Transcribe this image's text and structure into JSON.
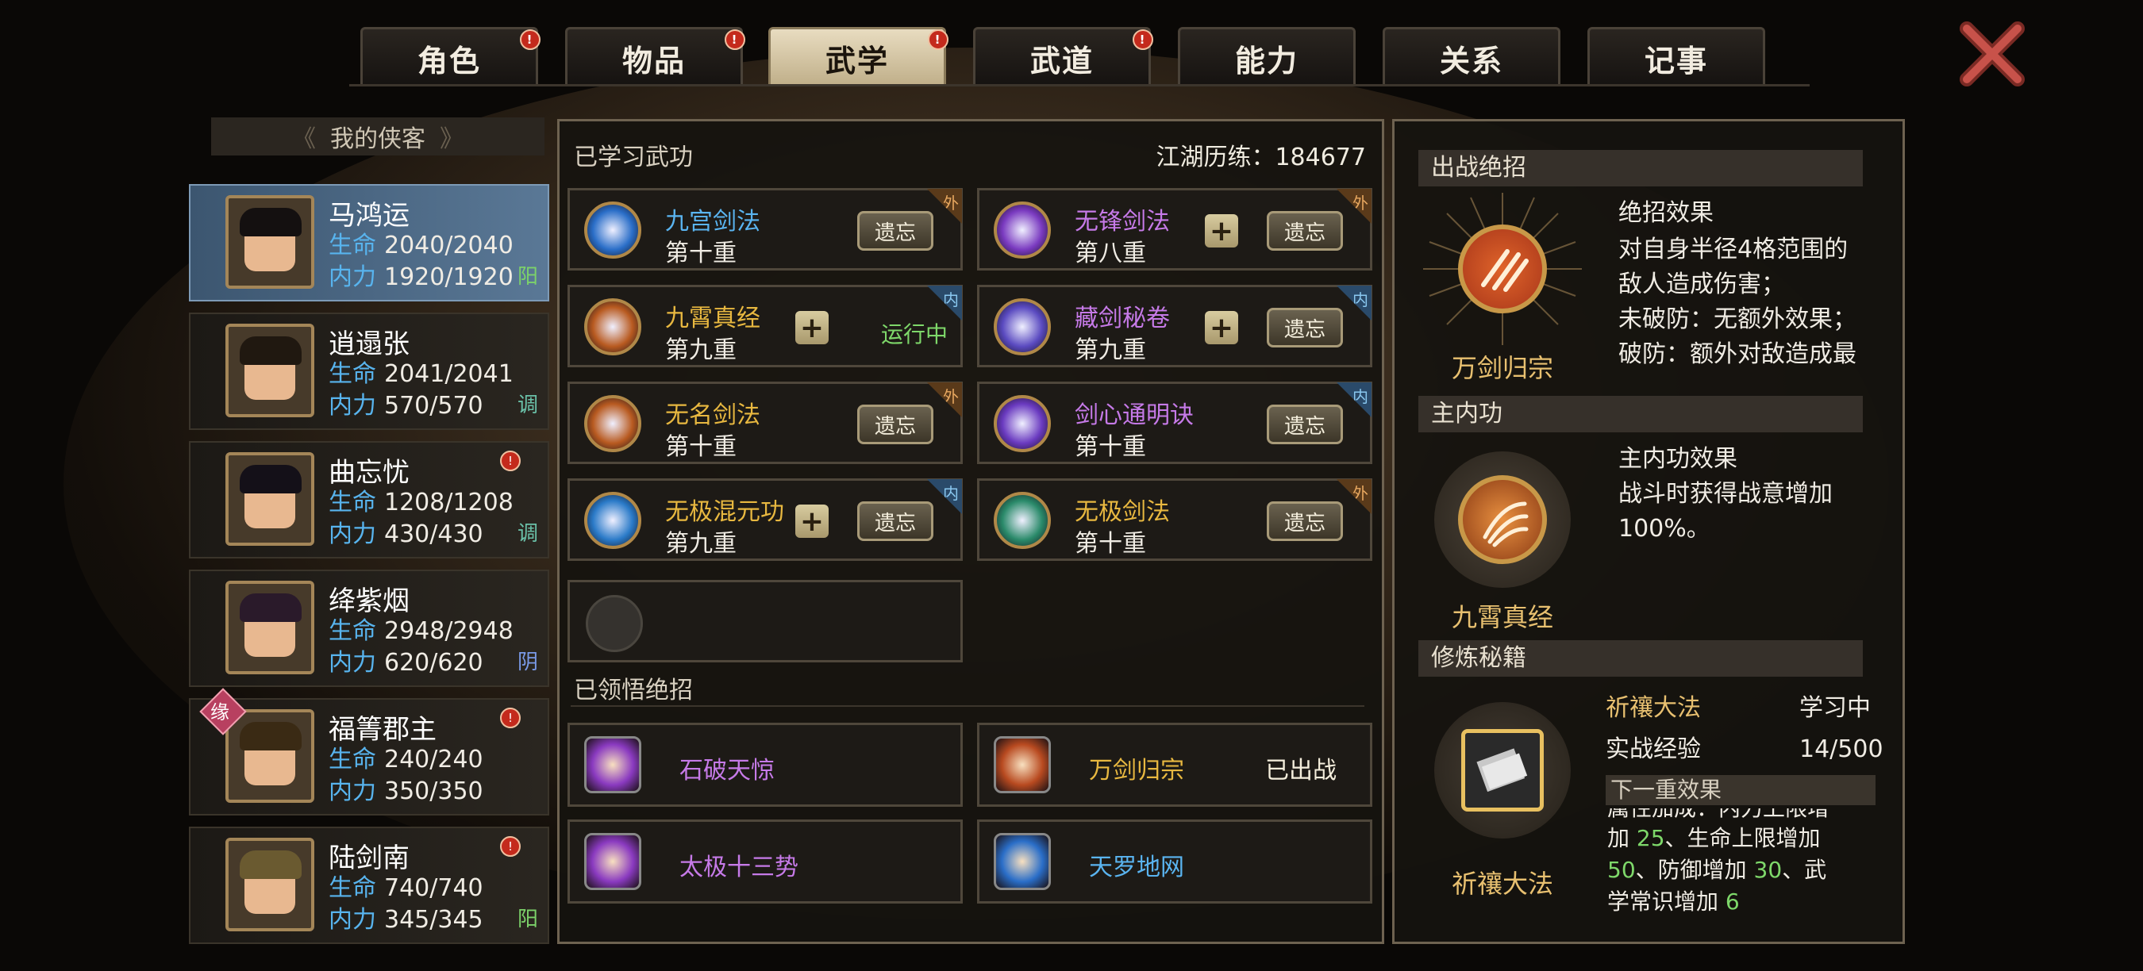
{
  "tabs": [
    {
      "label": "角色",
      "badge": "!"
    },
    {
      "label": "物品",
      "badge": "!"
    },
    {
      "label": "武学",
      "badge": "!",
      "active": true
    },
    {
      "label": "武道",
      "badge": "!"
    },
    {
      "label": "能力",
      "badge": ""
    },
    {
      "label": "关系",
      "badge": ""
    },
    {
      "label": "记事",
      "badge": ""
    }
  ],
  "roster": {
    "header": "我的侠客",
    "chars": [
      {
        "name": "马鸿运",
        "hp": "2040/2040",
        "mp": "1920/1920",
        "tag": "阳",
        "tag_color": "#7cd26a",
        "alert": false,
        "selected": true
      },
      {
        "name": "逍遢张",
        "hp": "2041/2041",
        "mp": "570/570",
        "tag": "调",
        "tag_color": "#6ac0a8",
        "alert": false
      },
      {
        "name": "曲忘忧",
        "hp": "1208/1208",
        "mp": "430/430",
        "tag": "调",
        "tag_color": "#6ac0a8",
        "alert": true
      },
      {
        "name": "绛紫烟",
        "hp": "2948/2948",
        "mp": "620/620",
        "tag": "阴",
        "tag_color": "#7a9ae8",
        "alert": false
      },
      {
        "name": "福箐郡主",
        "hp": "240/240",
        "mp": "350/350",
        "tag": "",
        "tag_color": "",
        "alert": true,
        "badge": "缘"
      },
      {
        "name": "陆剑南",
        "hp": "740/740",
        "mp": "345/345",
        "tag": "阳",
        "tag_color": "#7cd26a",
        "alert": true
      }
    ],
    "hp_label": "生命",
    "mp_label": "内力"
  },
  "learned": {
    "title": "已学习武功",
    "exp_label": "江湖历练：184677",
    "forget": "遗忘",
    "running": "运行中",
    "skills": [
      {
        "name": "九宫剑法",
        "level": "第十重",
        "type": "外",
        "name_color": "#5ab4f0",
        "plus": false,
        "icon_color": "#2a6ec8"
      },
      {
        "name": "无锋剑法",
        "level": "第八重",
        "type": "外",
        "name_color": "#c67ae8",
        "plus": true,
        "icon_color": "#7a3ac0"
      },
      {
        "name": "九霄真经",
        "level": "第九重",
        "type": "内",
        "name_color": "#e8b840",
        "plus": true,
        "running": true,
        "icon_color": "#b85a20"
      },
      {
        "name": "藏剑秘卷",
        "level": "第九重",
        "type": "内",
        "name_color": "#c67ae8",
        "plus": true,
        "icon_color": "#5a4ac0"
      },
      {
        "name": "无名剑法",
        "level": "第十重",
        "type": "外",
        "name_color": "#e8b840",
        "plus": false,
        "icon_color": "#b85a20"
      },
      {
        "name": "剑心通明诀",
        "level": "第十重",
        "type": "内",
        "name_color": "#c67ae8",
        "plus": false,
        "icon_color": "#6a3ac0"
      },
      {
        "name": "无极混元功",
        "level": "第九重",
        "type": "内",
        "name_color": "#e8b840",
        "plus": true,
        "icon_color": "#2a7ac8"
      },
      {
        "name": "无极剑法",
        "level": "第十重",
        "type": "外",
        "name_color": "#e8b840",
        "plus": false,
        "icon_color": "#2a8a6a"
      }
    ]
  },
  "ultimates": {
    "title": "已领悟绝招",
    "items": [
      {
        "name": "石破天惊",
        "color": "#c67ae8",
        "status": "",
        "icon_color": "#8a3ac0"
      },
      {
        "name": "万剑归宗",
        "color": "#e8b840",
        "status": "已出战",
        "icon_color": "#b84a20"
      },
      {
        "name": "太极十三势",
        "color": "#c67ae8",
        "status": "",
        "icon_color": "#8a3ac0"
      },
      {
        "name": "天罗地网",
        "color": "#5ab4f0",
        "status": "",
        "icon_color": "#2a6ec8"
      }
    ]
  },
  "battle_ult": {
    "header": "出战绝招",
    "name": "万剑归宗",
    "effect_title": "绝招效果",
    "effect_lines": [
      "对自身半径4格范围的",
      "敌人造成伤害；",
      "未破防：无额外效果；",
      "破防：额外对敌造成最"
    ]
  },
  "main_inner": {
    "header": "主内功",
    "name": "九霄真经",
    "effect_title": "主内功效果",
    "effect_lines": [
      "战斗时获得战意增加",
      "100%。"
    ]
  },
  "training": {
    "header": "修炼秘籍",
    "book": "祈禳大法",
    "status": "学习中",
    "exp_label": "实战经验",
    "exp_value": "14/500",
    "next_label": "下一重效果",
    "cut_line": "属性加成：内力上限增",
    "line1_a": "加 ",
    "v1": "25",
    "line1_b": "、生命上限增加",
    "v2": "50",
    "line2_b": "、防御增加 ",
    "v3": "30",
    "line2_c": "、武",
    "line3_a": "学常识增加 ",
    "v4": "6",
    "value_color": "#7ed86a"
  }
}
